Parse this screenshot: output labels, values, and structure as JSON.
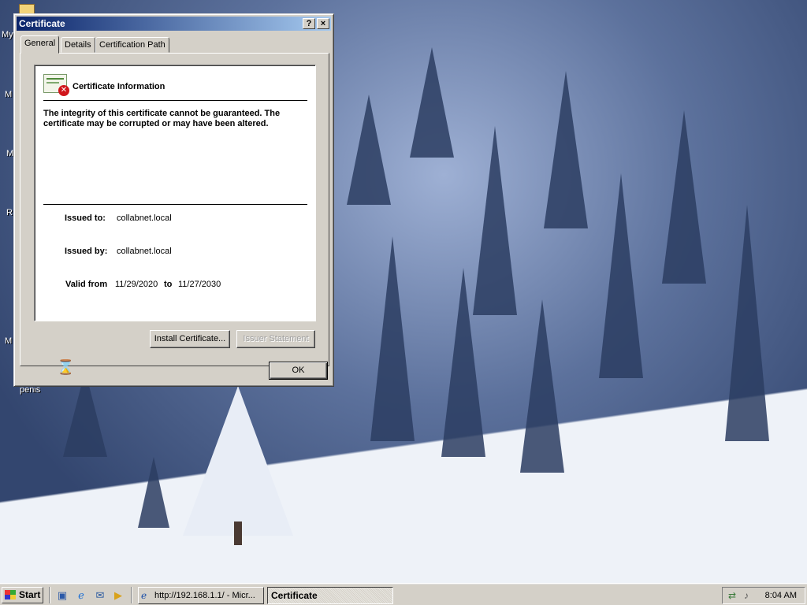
{
  "dialog": {
    "title": "Certificate",
    "help_button": "?",
    "close_button": "×",
    "tabs": [
      {
        "label": "General",
        "active": true
      },
      {
        "label": "Details",
        "active": false
      },
      {
        "label": "Certification Path",
        "active": false
      }
    ],
    "info_title": "Certificate Information",
    "warning": "The integrity of this certificate cannot be guaranteed. The certificate may be corrupted or may have been altered.",
    "issued_to_label": "Issued to:",
    "issued_to_value": "collabnet.local",
    "issued_by_label": "Issued by:",
    "issued_by_value": "collabnet.local",
    "valid_from_label": "Valid from",
    "valid_from_value": "11/29/2020",
    "valid_to_label": "to",
    "valid_to_value": "11/27/2030",
    "install_button": "Install Certificate...",
    "issuer_statement_button": "Issuer Statement",
    "ok_button": "OK",
    "icon": "certificate-error-icon"
  },
  "desktop": {
    "icons": [
      {
        "label": "My",
        "icon": "folder-icon"
      },
      {
        "label": "M"
      },
      {
        "label": "M"
      },
      {
        "label": "R"
      },
      {
        "label": "M"
      },
      {
        "label": "penis"
      }
    ]
  },
  "taskbar": {
    "start_label": "Start",
    "quick_launch": [
      "desktop-icon",
      "ie-icon",
      "outlook-icon",
      "media-icon"
    ],
    "tasks": [
      {
        "label": "http://192.168.1.1/ - Micr...",
        "icon": "ie-icon",
        "active": false
      },
      {
        "label": "Certificate",
        "active": true
      }
    ],
    "clock": "8:04 AM",
    "tray_icons": [
      "network-icon",
      "volume-icon"
    ]
  },
  "colors": {
    "titlebar_start": "#0a246a",
    "titlebar_end": "#a6caf0",
    "face": "#d4d0c8",
    "error_badge": "#d0161b"
  }
}
